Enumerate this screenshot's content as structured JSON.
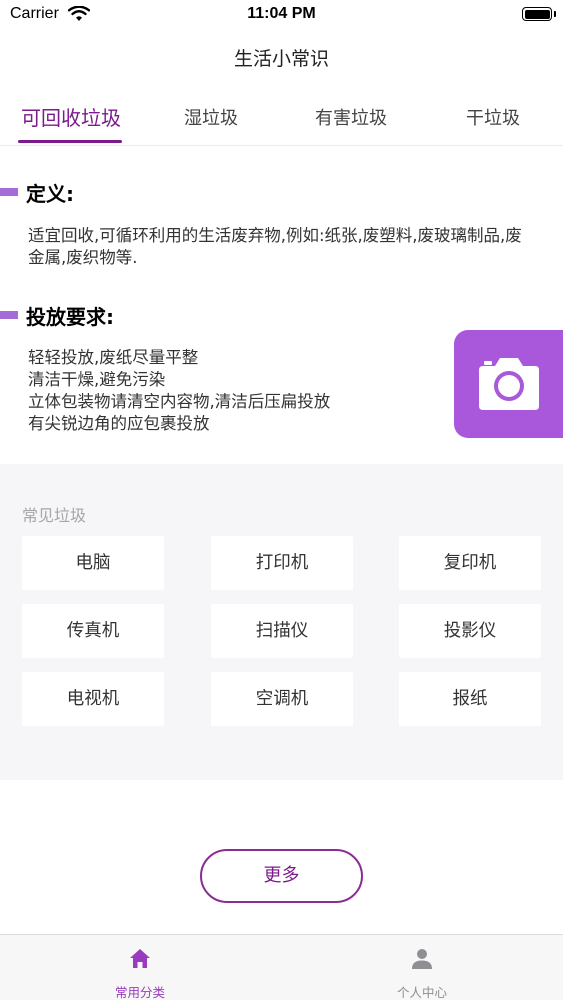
{
  "status_bar": {
    "carrier": "Carrier",
    "time": "11:04 PM"
  },
  "nav": {
    "title": "生活小常识"
  },
  "tabs": [
    {
      "label": "可回收垃圾",
      "active": true
    },
    {
      "label": "湿垃圾",
      "active": false
    },
    {
      "label": "有害垃圾",
      "active": false
    },
    {
      "label": "干垃圾",
      "active": false
    }
  ],
  "definition": {
    "title": "定义:",
    "text": "适宜回收,可循环利用的生活废弃物,例如:纸张,废塑料,废玻璃制品,废金属,废织物等."
  },
  "requirements": {
    "title": "投放要求:",
    "items": [
      "轻轻投放,废纸尽量平整",
      "清洁干燥,避免污染",
      "立体包装物请清空内容物,清洁后压扁投放",
      "有尖锐边角的应包裹投放"
    ]
  },
  "camera_button": {
    "icon": "camera-icon"
  },
  "common": {
    "label": "常见垃圾",
    "items": [
      "电脑",
      "打印机",
      "复印机",
      "传真机",
      "扫描仪",
      "投影仪",
      "电视机",
      "空调机",
      "报纸"
    ]
  },
  "more_button": {
    "label": "更多"
  },
  "tabbar": [
    {
      "label": "常用分类",
      "icon": "home-icon",
      "active": true
    },
    {
      "label": "个人中心",
      "icon": "person-icon",
      "active": false
    }
  ],
  "colors": {
    "accent": "#7c1b8c",
    "section_bar": "#a56bd6",
    "camera_button": "#a957db",
    "panel_background": "#f6f6f9",
    "tabbar_active": "#9a3bbf",
    "tabbar_inactive": "#8e8e93"
  }
}
